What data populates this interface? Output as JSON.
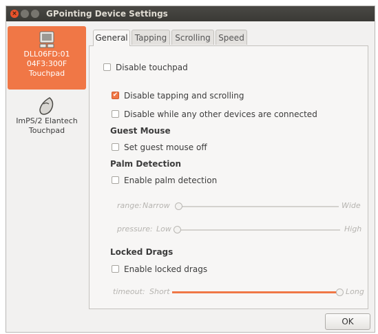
{
  "window": {
    "title": "GPointing Device Settings",
    "close_glyph": "×"
  },
  "sidebar": {
    "devices": [
      {
        "lines": [
          "DLL06FD:01",
          "04F3:300F",
          "Touchpad"
        ],
        "icon": "touchpad-icon"
      },
      {
        "lines": [
          "ImPS/2 Elantech",
          "Touchpad"
        ],
        "icon": "mouse-icon"
      }
    ]
  },
  "tabs": [
    {
      "label": "General"
    },
    {
      "label": "Tapping"
    },
    {
      "label": "Scrolling"
    },
    {
      "label": "Speed"
    }
  ],
  "general": {
    "disable_touchpad": {
      "label": "Disable touchpad",
      "checked": false
    },
    "disable_tapping": {
      "label": "Disable tapping and scrolling",
      "checked": true
    },
    "disable_while_other": {
      "label": "Disable while any other devices are connected",
      "checked": false
    },
    "guest_mouse": {
      "heading": "Guest Mouse",
      "set_off": {
        "label": "Set guest mouse off",
        "checked": false
      }
    },
    "palm_detection": {
      "heading": "Palm Detection",
      "enable": {
        "label": "Enable palm detection",
        "checked": false
      },
      "range": {
        "label": "range:",
        "min": "Narrow",
        "max": "Wide",
        "level": 0.0
      },
      "pressure": {
        "label": "pressure:",
        "min": "Low",
        "max": "High",
        "level": 0.0
      }
    },
    "locked_drags": {
      "heading": "Locked Drags",
      "enable": {
        "label": "Enable locked drags",
        "checked": false
      },
      "timeout": {
        "label": "timeout:",
        "min": "Short",
        "max": "Long",
        "level": 1.0
      }
    }
  },
  "buttons": {
    "ok": "OK"
  },
  "colors": {
    "accent": "#f07746",
    "titlebar": "#3c3b37"
  }
}
